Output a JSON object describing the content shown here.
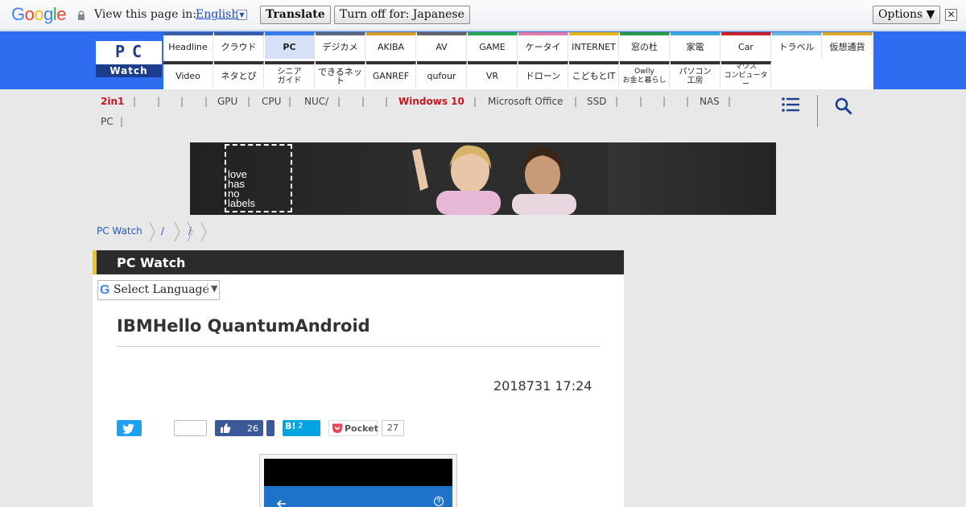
{
  "translate_bar": {
    "logo_letters": [
      "G",
      "o",
      "o",
      "g",
      "l",
      "e"
    ],
    "logo_colors": [
      "#4285f4",
      "#ea4335",
      "#fbbc05",
      "#4285f4",
      "#34a853",
      "#ea4335"
    ],
    "view_text": "View this page in:",
    "language": "English",
    "language_arrow": "▼",
    "translate_label": "Translate",
    "turn_off_label": "Turn off for: Japanese",
    "options_label": "Options ▼",
    "close_glyph": "✕"
  },
  "site": {
    "logo_top": "PC",
    "logo_bottom": "Watch",
    "accent": "#2e6cf0"
  },
  "nav_row1": [
    {
      "label": "Headline",
      "color": "#3a5da8"
    },
    {
      "label": "クラウド",
      "color": "#3a5da8"
    },
    {
      "label": "PC",
      "color": "#3a7bea",
      "active": true
    },
    {
      "label": "デジカメ",
      "color": "#5a6a7c"
    },
    {
      "label": "AKIBA",
      "color": "#d49a2a"
    },
    {
      "label": "AV",
      "color": "#666666"
    },
    {
      "label": "GAME",
      "color": "#2aa652"
    },
    {
      "label": "ケータイ",
      "color": "#e07aa8"
    },
    {
      "label": "INTERNET",
      "color": "#e6b422"
    },
    {
      "label": "窓の杜",
      "color": "#2a9a4a"
    },
    {
      "label": "家電",
      "color": "#3aaad8"
    },
    {
      "label": "Car",
      "color": "#c8232c"
    },
    {
      "label": "トラベル",
      "color": "#6ab4e0"
    },
    {
      "label": "仮想通貨",
      "color": "#e0a82a"
    }
  ],
  "nav_row2": [
    {
      "label": "Video"
    },
    {
      "label": "ネタとぴ"
    },
    {
      "label": "シニア\nガイド"
    },
    {
      "label": "できるネット"
    },
    {
      "label": "GANREF"
    },
    {
      "label": "qufour"
    },
    {
      "label": "VR"
    },
    {
      "label": "ドローン"
    },
    {
      "label": "こどもとIT"
    },
    {
      "label": "Owlly\nお金と暮らし"
    },
    {
      "label": "パソコン\n工房"
    },
    {
      "label": "マウス\nコンピューター"
    }
  ],
  "tags_row1": [
    {
      "label": "2in1",
      "red": true
    },
    {
      "label": ""
    },
    {
      "label": ""
    },
    {
      "label": ""
    },
    {
      "label": "GPU"
    },
    {
      "label": "CPU"
    },
    {
      "label": "NUC/"
    },
    {
      "label": ""
    },
    {
      "label": ""
    },
    {
      "label": "Windows 10",
      "red": true
    },
    {
      "label": "Microsoft Office"
    },
    {
      "label": "SSD"
    },
    {
      "label": ""
    },
    {
      "label": ""
    },
    {
      "label": ""
    },
    {
      "label": "NAS"
    }
  ],
  "tags_row2": [
    {
      "label": "PC"
    }
  ],
  "banner": {
    "text_lines": [
      "love",
      "has",
      "no",
      "labels"
    ]
  },
  "breadcrumb": [
    "PC Watch",
    "/",
    "",
    "/",
    ""
  ],
  "article": {
    "section_title": "PC Watch",
    "language_select": "Select Language",
    "language_select_g": "G",
    "language_select_arrow": "▼",
    "title": "IBMHello QuantumAndroid",
    "date": "2018731 17:24"
  },
  "social": {
    "facebook_count": "26",
    "hatena_label": "B!",
    "hatena_count": "2",
    "pocket_label": "Pocket",
    "pocket_count": "27"
  }
}
